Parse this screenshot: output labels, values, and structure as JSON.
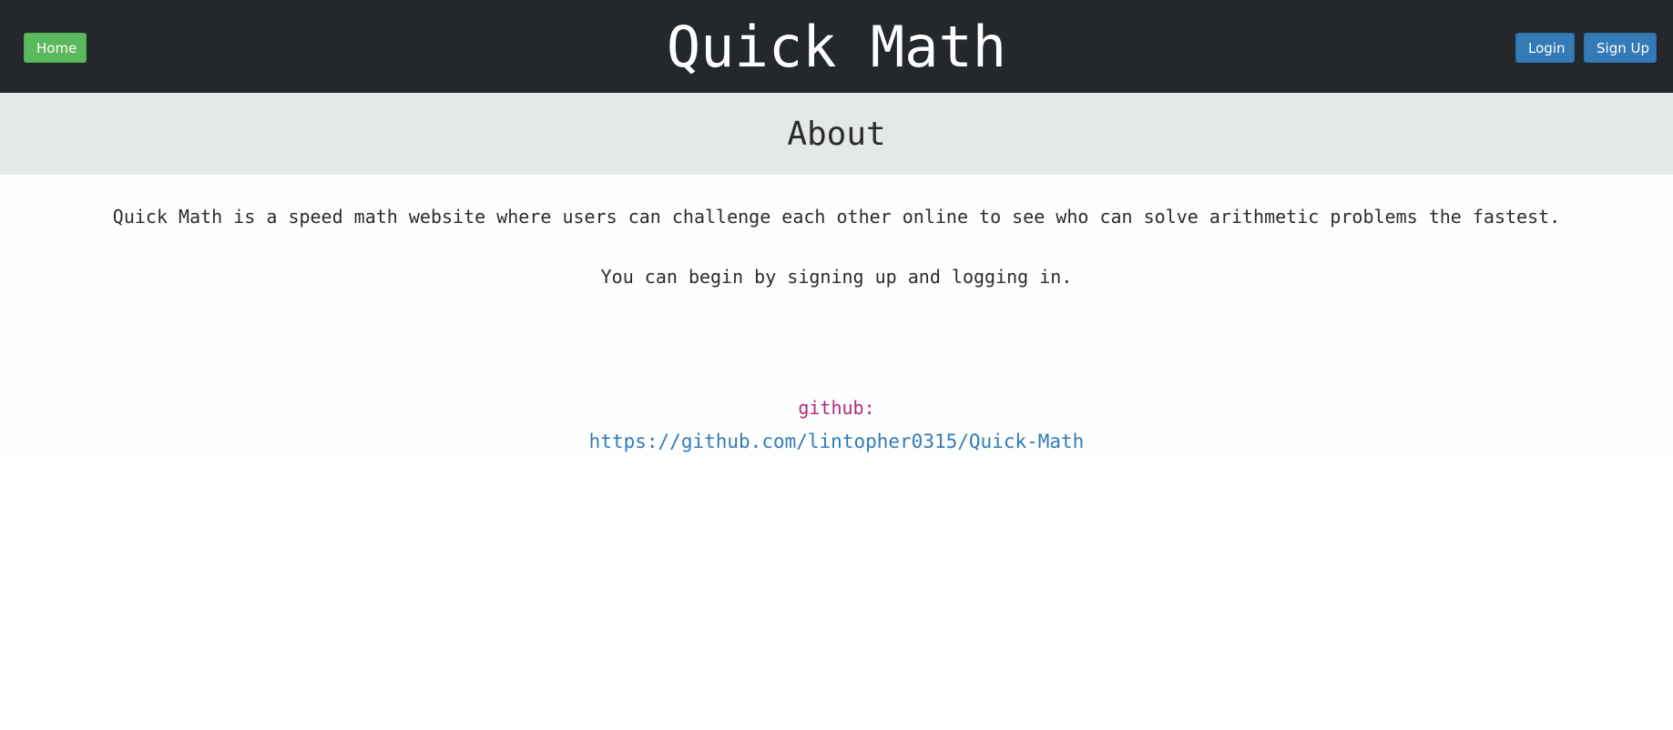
{
  "navbar": {
    "home_label": "Home",
    "title": "Quick Math",
    "login_label": "Login",
    "signup_label": "Sign Up"
  },
  "about": {
    "heading": "About",
    "description": "Quick Math is a speed math website where users can challenge each other online to see who can solve arithmetic problems the fastest.",
    "instructions": "You can begin by signing up and logging in.",
    "github_label": "github:",
    "github_url": "https://github.com/lintopher0315/Quick-Math"
  },
  "colors": {
    "navbar_bg": "#24282c",
    "home_button": "#5cb85c",
    "primary_button": "#337ab7",
    "jumbotron_bg": "#e5e8e9",
    "link": "#337ab7",
    "github_label": "#b5287a"
  }
}
